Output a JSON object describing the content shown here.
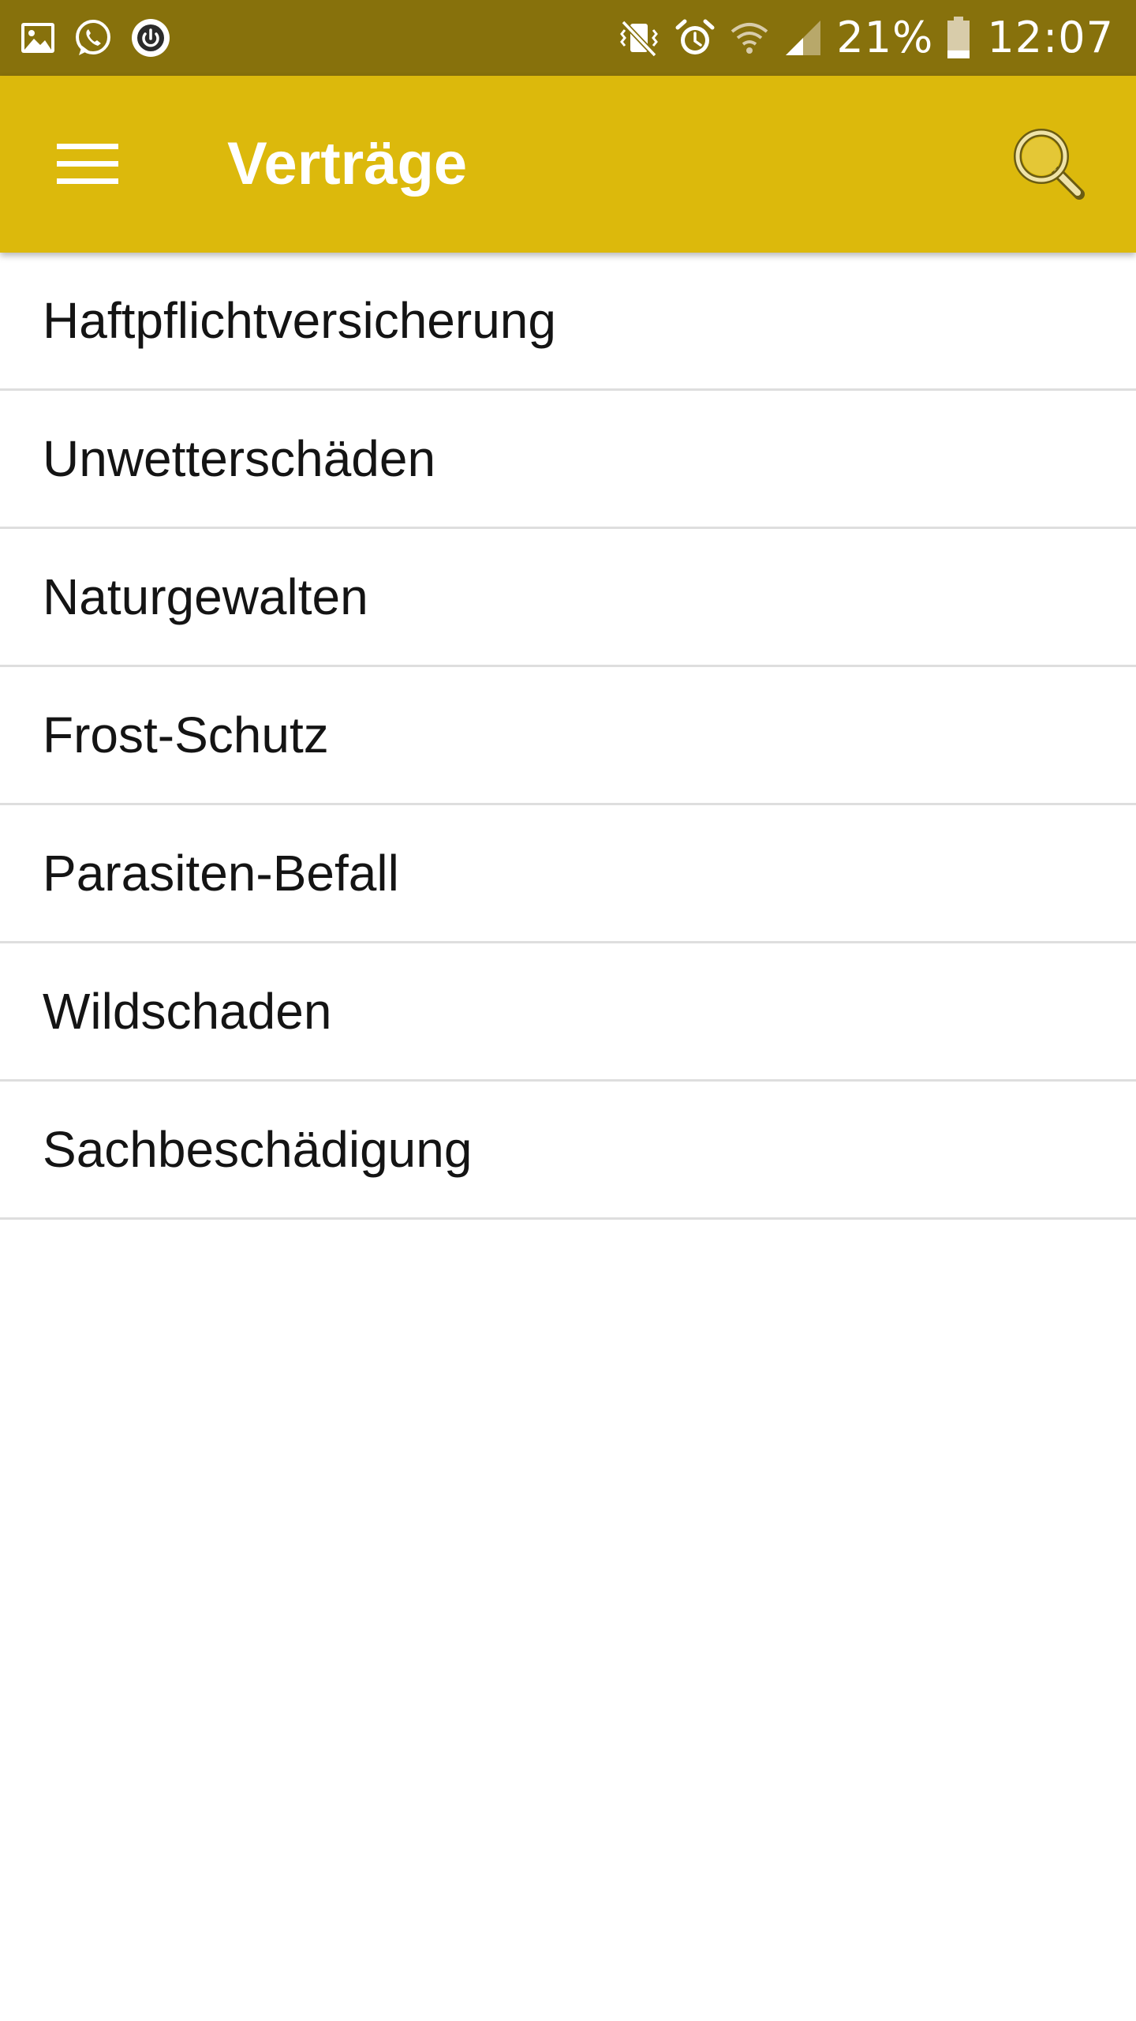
{
  "status_bar": {
    "left_icons": [
      "gallery-icon",
      "whatsapp-icon",
      "power-icon"
    ],
    "right_icons": [
      "vibrate-icon",
      "alarm-icon",
      "wifi-icon",
      "signal-icon"
    ],
    "battery_percent": "21%",
    "battery_level": 0.21,
    "time": "12:07"
  },
  "app_bar": {
    "title": "Verträge",
    "menu_icon": "hamburger-menu-icon",
    "search_icon": "search-icon",
    "background_color": "#dcb90c",
    "status_color": "#87710c"
  },
  "contracts": {
    "items": [
      {
        "label": "Haftpflichtversicherung"
      },
      {
        "label": "Unwetterschäden"
      },
      {
        "label": "Naturgewalten"
      },
      {
        "label": "Frost-Schutz"
      },
      {
        "label": "Parasiten-Befall"
      },
      {
        "label": "Wildschaden"
      },
      {
        "label": "Sachbeschädigung"
      }
    ]
  }
}
